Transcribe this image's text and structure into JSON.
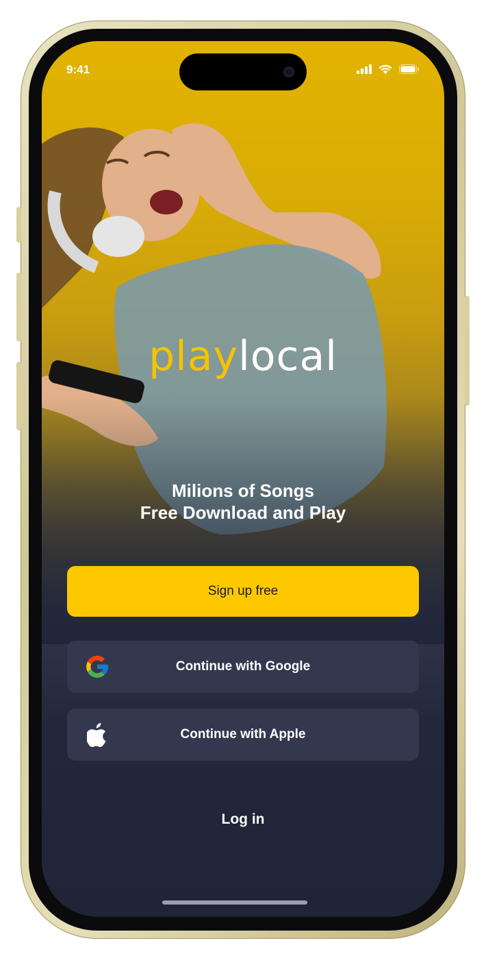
{
  "status_bar": {
    "time": "9:41",
    "icons": [
      "cellular-signal-icon",
      "wifi-icon",
      "battery-icon"
    ]
  },
  "brand": {
    "logo_part1": "play",
    "logo_part2": "local",
    "accent_color": "#fdc800",
    "background_color": "#1f2436"
  },
  "hero": {
    "tagline_line1": "Milions of Songs",
    "tagline_line2": "Free Download and Play",
    "background_image": "woman-with-headphones-dancing-photo"
  },
  "actions": {
    "signup_label": "Sign up free",
    "google_label": "Continue with Google",
    "apple_label": "Continue with Apple",
    "login_label": "Log in"
  }
}
